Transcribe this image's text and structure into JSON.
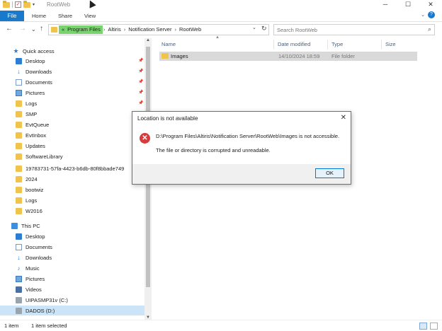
{
  "window": {
    "title": "RootWeb",
    "controls": {
      "minimize": "─",
      "maximize": "☐",
      "close": "✕"
    }
  },
  "ribbon": {
    "tabs": [
      "File",
      "Home",
      "Share",
      "View"
    ],
    "help": "?",
    "expand": "⌄"
  },
  "address": {
    "back": "←",
    "forward": "→",
    "recent": "⌄",
    "up": "↑",
    "crumbs": [
      "«",
      "Program Files",
      "›",
      "Altiris",
      "›",
      "Notification Server",
      "›",
      "RootWeb"
    ],
    "dropdown": "⌄",
    "refresh": "↻",
    "search_placeholder": "Search RootWeb",
    "search_icon": "search-icon"
  },
  "navpane": {
    "quick_access": "Quick access",
    "quick_items": [
      "Desktop",
      "Downloads",
      "Documents",
      "Pictures",
      "Logs",
      "SMP",
      "EvtQueue",
      "EvtInbox",
      "Updates",
      "SoftwareLibrary",
      "19783731-57fa-4423-b6db-80f8bbade749",
      "2024",
      "bootwiz",
      "Logs",
      "W2016"
    ],
    "this_pc": "This PC",
    "pc_items": [
      "Desktop",
      "Documents",
      "Downloads",
      "Music",
      "Pictures",
      "Videos",
      "UIPASMP31v (C:)",
      "DADOS (D:)"
    ]
  },
  "content": {
    "columns": [
      "Name",
      "Date modified",
      "Type",
      "Size"
    ],
    "files": [
      {
        "name": "Images",
        "date": "14/10/2024 18:59",
        "type": "File folder",
        "size": ""
      }
    ]
  },
  "status": {
    "count": "1 item",
    "selected": "1 item selected"
  },
  "dialog": {
    "title": "Location is not available",
    "close": "✕",
    "message1": "D:\\Program Files\\Altiris\\Notification Server\\RootWeb\\Images is not accessible.",
    "message2": "The file or directory is corrupted and unreadable.",
    "ok": "OK",
    "error_glyph": "✕"
  },
  "colors": {
    "accent": "#1979ca",
    "address_highlight": "#79d36e",
    "selection": "#cce4f7",
    "error": "#d83b3b"
  }
}
